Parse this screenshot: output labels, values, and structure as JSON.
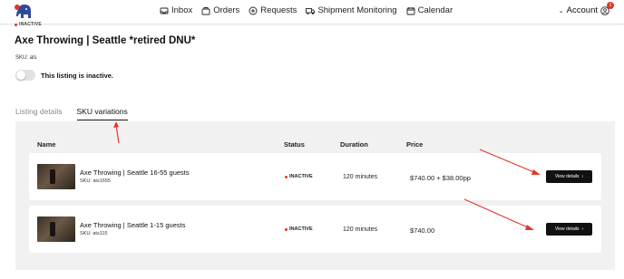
{
  "nav": {
    "items": [
      {
        "label": "Inbox",
        "icon": "inbox-icon"
      },
      {
        "label": "Orders",
        "icon": "orders-icon"
      },
      {
        "label": "Requests",
        "icon": "plus-circle-icon"
      },
      {
        "label": "Shipment Monitoring",
        "icon": "truck-icon"
      },
      {
        "label": "Calendar",
        "icon": "calendar-icon"
      }
    ],
    "account_label": "Account",
    "notification_count": "1"
  },
  "listing": {
    "status": "INACTIVE",
    "title": "Axe Throwing | Seattle *retired DNU*",
    "sku": "SKU: ats",
    "toggle_label": "This listing is inactive."
  },
  "tabs": [
    {
      "label": "Listing details",
      "active": false
    },
    {
      "label": "SKU variations",
      "active": true
    }
  ],
  "table": {
    "headers": {
      "name": "Name",
      "status": "Status",
      "duration": "Duration",
      "price": "Price"
    },
    "rows": [
      {
        "name": "Axe Throwing | Seattle 16-55 guests",
        "sku": "SKU: ats1655",
        "status": "INACTIVE",
        "duration": "120 minutes",
        "price": "$740.00 + $38.00pp",
        "button": "View details"
      },
      {
        "name": "Axe Throwing | Seattle 1-15 guests",
        "sku": "SKU: ats115",
        "status": "INACTIVE",
        "duration": "120 minutes",
        "price": "$740.00",
        "button": "View details"
      }
    ]
  },
  "colors": {
    "accent_red": "#d9372b",
    "button_bg": "#111111",
    "panel_bg": "#f1f1f1"
  }
}
